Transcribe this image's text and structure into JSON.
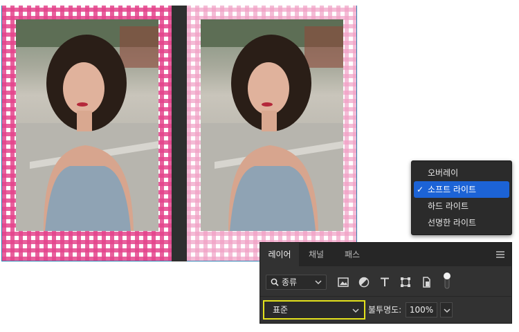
{
  "canvas": {
    "left_frame_color": "#e4448c",
    "right_frame_color": "#f0a0c4"
  },
  "blend_menu": {
    "items": [
      {
        "label": "오버레이",
        "selected": false
      },
      {
        "label": "소프트 라이트",
        "selected": true
      },
      {
        "label": "하드 라이트",
        "selected": false
      },
      {
        "label": "선명한 라이트",
        "selected": false
      }
    ],
    "check_mark": "✓",
    "highlight_color": "#1c63d6"
  },
  "layers_panel": {
    "tabs": [
      {
        "label": "레이어",
        "active": true
      },
      {
        "label": "채널",
        "active": false
      },
      {
        "label": "패스",
        "active": false
      }
    ],
    "filter": {
      "kind_label": "종류",
      "icons": [
        "pixel-layer-filter-icon",
        "adjustment-layer-filter-icon",
        "type-layer-filter-icon",
        "shape-layer-filter-icon",
        "smart-object-filter-icon",
        "filter-toggle-icon"
      ]
    },
    "blend_mode": {
      "value": "표준",
      "highlight_color": "#e4e21c"
    },
    "opacity": {
      "label": "불투명도:",
      "value": "100%"
    }
  }
}
